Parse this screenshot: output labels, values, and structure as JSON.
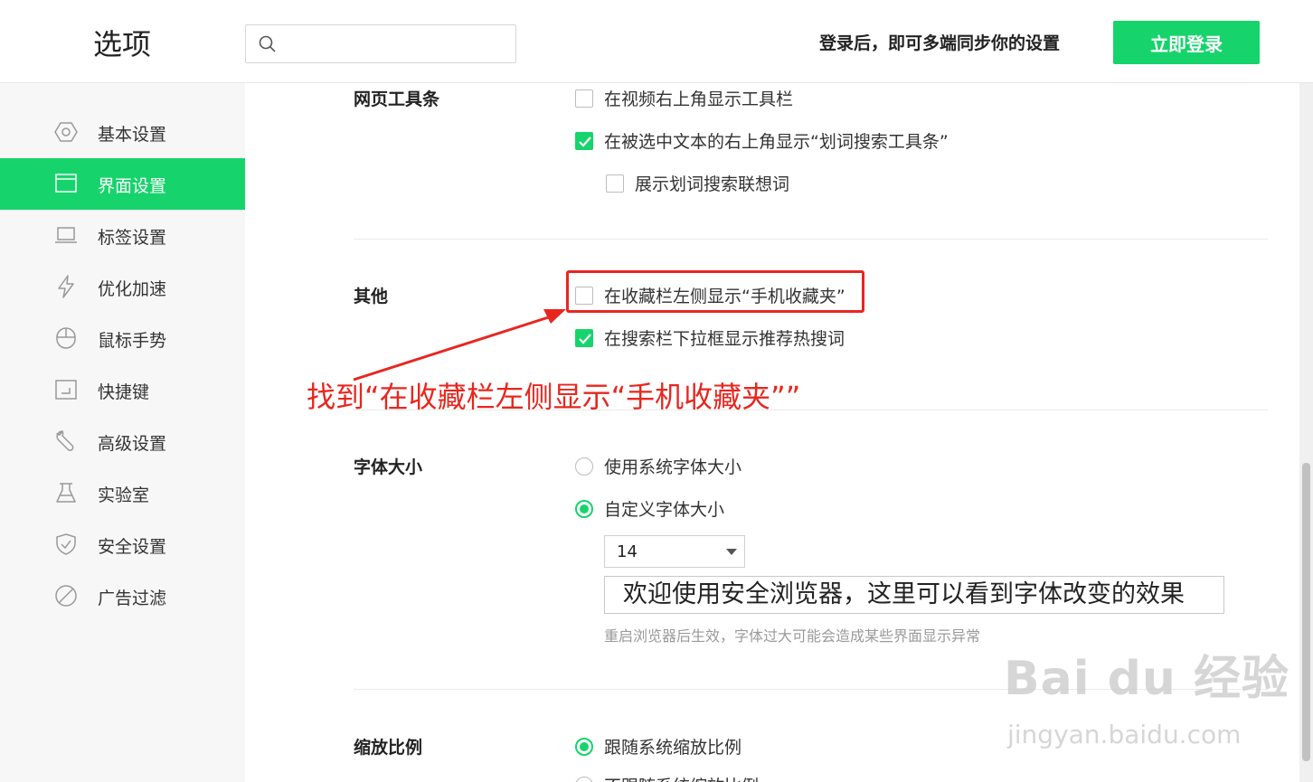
{
  "header": {
    "title": "选项",
    "search_placeholder": "",
    "login_tip": "登录后，即可多端同步你的设置",
    "login_button": "立即登录"
  },
  "sidebar": {
    "items": [
      {
        "label": "基本设置",
        "icon": "hexagon-settings-icon",
        "active": false
      },
      {
        "label": "界面设置",
        "icon": "window-icon",
        "active": true
      },
      {
        "label": "标签设置",
        "icon": "tab-icon",
        "active": false
      },
      {
        "label": "优化加速",
        "icon": "lightning-icon",
        "active": false
      },
      {
        "label": "鼠标手势",
        "icon": "mouse-icon",
        "active": false
      },
      {
        "label": "快捷键",
        "icon": "shortcut-key-icon",
        "active": false
      },
      {
        "label": "高级设置",
        "icon": "wrench-icon",
        "active": false
      },
      {
        "label": "实验室",
        "icon": "flask-icon",
        "active": false
      },
      {
        "label": "安全设置",
        "icon": "shield-icon",
        "active": false
      },
      {
        "label": "广告过滤",
        "icon": "block-icon",
        "active": false
      }
    ]
  },
  "toolbar_section": {
    "label": "网页工具条",
    "options": [
      {
        "label": "在视频右上角显示工具栏",
        "checked": false
      },
      {
        "label": "在被选中文本的右上角显示“划词搜索工具条”",
        "checked": true
      },
      {
        "label": "展示划词搜索联想词",
        "checked": false
      }
    ]
  },
  "other_section": {
    "label": "其他",
    "options": [
      {
        "label": "在收藏栏左侧显示“手机收藏夹”",
        "checked": false
      },
      {
        "label": "在搜索栏下拉框显示推荐热搜词",
        "checked": true
      }
    ]
  },
  "annotation": "找到“在收藏栏左侧显示“手机收藏夹””",
  "font_section": {
    "label": "字体大小",
    "options": [
      {
        "label": "使用系统字体大小",
        "checked": false
      },
      {
        "label": "自定义字体大小",
        "checked": true
      }
    ],
    "size_value": "14",
    "preview_text": "欢迎使用安全浏览器，这里可以看到字体改变的效果",
    "hint": "重启浏览器后生效，字体过大可能会造成某些界面显示异常"
  },
  "zoom_section": {
    "label": "缩放比例",
    "options": [
      {
        "label": "跟随系统缩放比例",
        "checked": true
      },
      {
        "label": "不跟随系统缩放比例",
        "checked": false
      }
    ]
  },
  "watermark": {
    "brand": "Bai du 经验",
    "url": "jingyan.baidu.com"
  },
  "colors": {
    "accent": "#16d46b",
    "annotation": "#e8261f"
  }
}
